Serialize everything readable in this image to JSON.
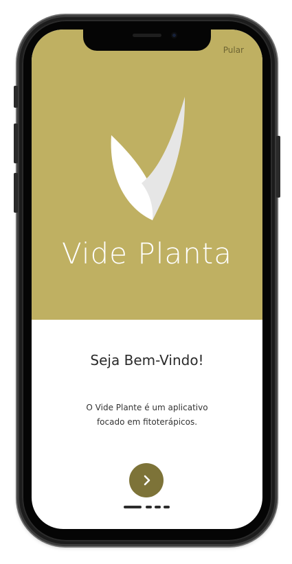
{
  "header": {
    "skip_label": "Pular"
  },
  "hero": {
    "app_name": "Vide Planta",
    "logo_icon": "leaf-check-icon",
    "background": "#bfb062"
  },
  "content": {
    "title": "Seja Bem-Vindo!",
    "description_lines": [
      "O Vide Plante é um aplicativo",
      "focado em fitoterápicos."
    ]
  },
  "navigation": {
    "next_icon": "chevron-right-icon",
    "next_color": "#7d7338",
    "page_count": 4,
    "current_page": 1
  }
}
